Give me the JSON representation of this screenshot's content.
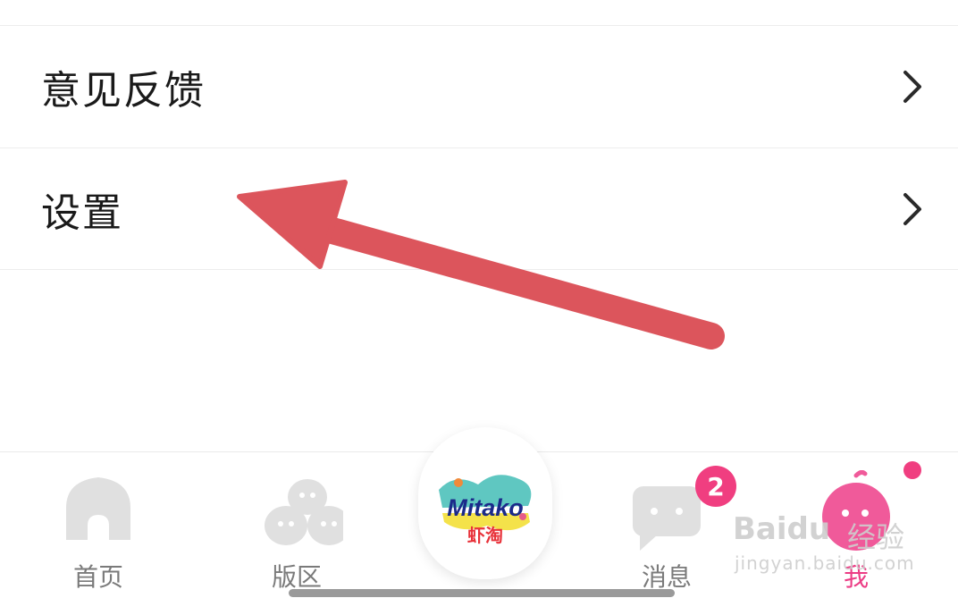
{
  "menu": {
    "items": [
      {
        "label": "意见反馈",
        "icon": "chevron-right-icon"
      },
      {
        "label": "设置",
        "icon": "chevron-right-icon"
      }
    ]
  },
  "annotation": {
    "arrow_color": "#dc555c",
    "icon": "arrow-annotation"
  },
  "tabbar": {
    "tabs": [
      {
        "label": "首页",
        "icon": "home-icon"
      },
      {
        "label": "版区",
        "icon": "board-icon"
      },
      {
        "label": "消息",
        "icon": "message-icon",
        "badge": "2"
      },
      {
        "label": "我",
        "icon": "me-icon",
        "active": true
      }
    ],
    "center": {
      "logo_text": "Mitako",
      "logo_subtext": "虾淘",
      "icon": "mitako-logo-icon"
    },
    "colors": {
      "active": "#ec3c85",
      "inactive": "#7a7a7a",
      "icon_inactive": "#e0e0e0",
      "badge": "#f03e80"
    }
  },
  "watermark": {
    "brand": "Baidu",
    "cn": "经验",
    "url": "jingyan.baidu.com"
  }
}
